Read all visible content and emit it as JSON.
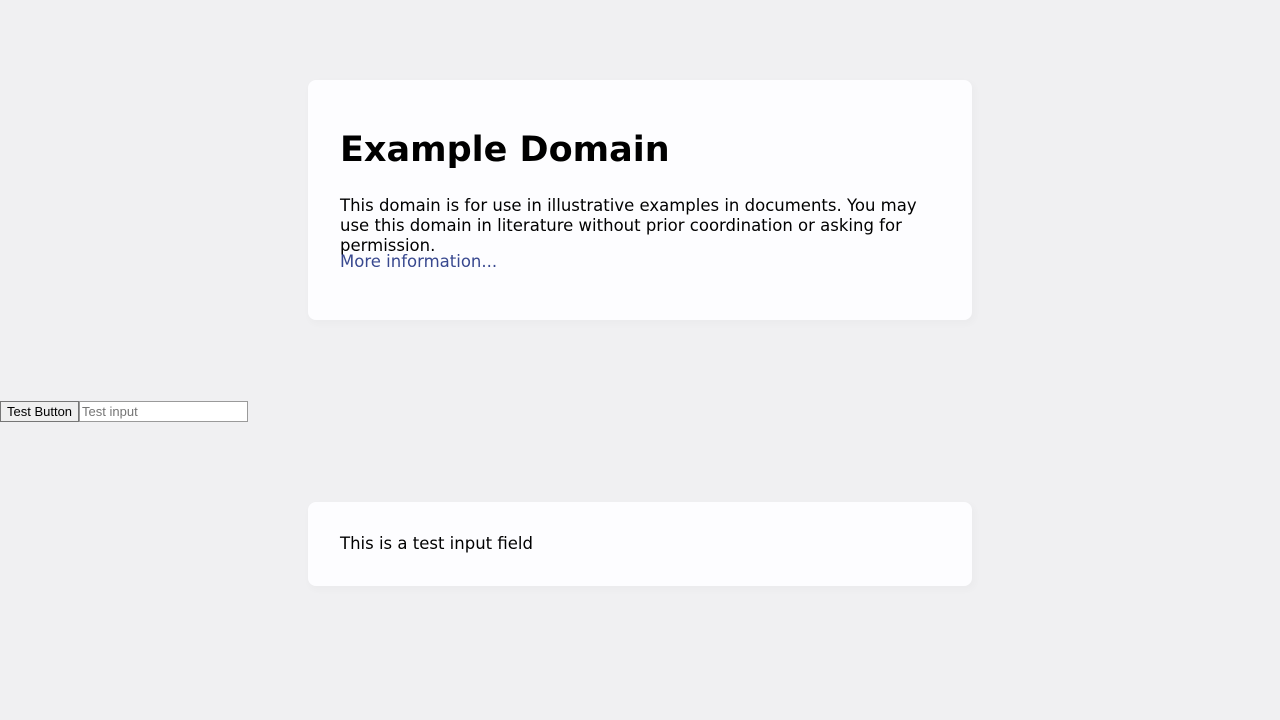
{
  "main_card": {
    "title": "Example Domain",
    "description": "This domain is for use in illustrative examples in documents. You may use this domain in literature without prior coordination or asking for permission.",
    "link_text": "More information..."
  },
  "test_controls": {
    "button_label": "Test Button",
    "input_placeholder": "Test input",
    "input_value": ""
  },
  "note_card": {
    "text": "This is a test input field"
  },
  "colors": {
    "background": "#f0f0f2",
    "card": "#fdfdff",
    "link": "#38488f"
  }
}
